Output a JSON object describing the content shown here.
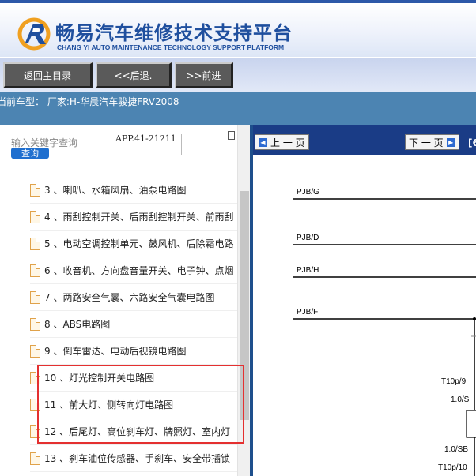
{
  "header": {
    "title_cn": "畅易汽车维修技术支持平台",
    "title_en": "CHANG YI AUTO MAINTENANCE TECHNOLOGY SUPPORT PLATFORM",
    "logo_icon": "cy-logo-icon",
    "brand_color": "#1f4f9e"
  },
  "nav": {
    "home": "返回主目录",
    "back": "<<后退.",
    "forward": ">>前进"
  },
  "car": {
    "text": "当前车型：  厂家:H-华晨汽车骏捷FRV2008"
  },
  "search": {
    "placeholder": "输入关键字查询",
    "button": "查询",
    "code": "APP.41-21211"
  },
  "tree": {
    "items": [
      {
        "label": "3 、喇叭、水箱风扇、油泵电路图"
      },
      {
        "label": "4 、雨刮控制开关、后雨刮控制开关、前雨刮"
      },
      {
        "label": "5 、电动空调控制单元、鼓风机、后除霜电路"
      },
      {
        "label": "6 、收音机、方向盘音量开关、电子钟、点烟"
      },
      {
        "label": "7 、两路安全气囊、六路安全气囊电路图"
      },
      {
        "label": "8 、ABS电路图"
      },
      {
        "label": "9 、倒车雷达、电动后视镜电路图"
      },
      {
        "label": "10 、灯光控制开关电路图"
      },
      {
        "label": "11 、前大灯、侧转向灯电路图"
      },
      {
        "label": "12 、后尾灯、高位刹车灯、牌照灯、室内灯"
      },
      {
        "label": "13 、刹车油位传感器、手刹车、安全带插锁"
      }
    ]
  },
  "viewer": {
    "prev": "上 一 页",
    "next": "下 一 页",
    "bracket": "[6",
    "wires": [
      "PJB/G",
      "PJB/D",
      "PJB/H",
      "PJB/F"
    ],
    "connectors": [
      "T10p/9",
      "1.0/S",
      "1.0/SB",
      "T10p/10"
    ]
  }
}
